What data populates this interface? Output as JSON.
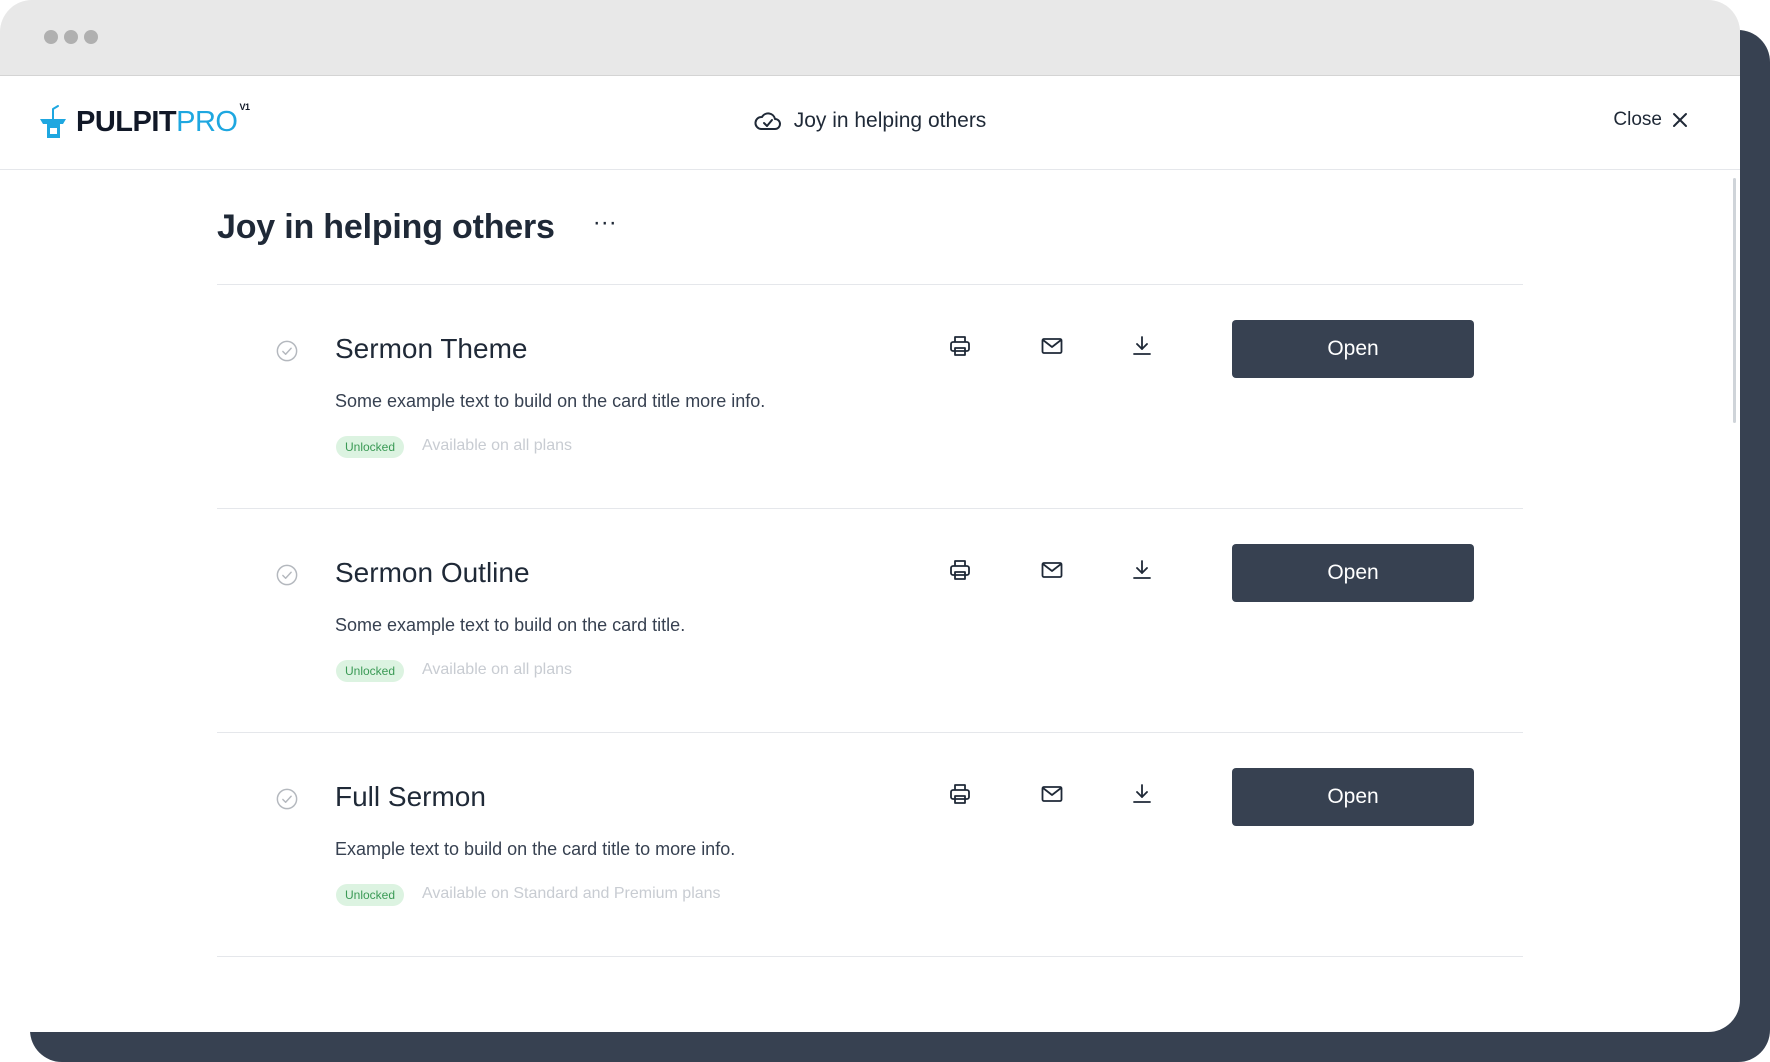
{
  "app": {
    "logo_pulpit": "PULPIT",
    "logo_pro": "PRO",
    "logo_version": "V1",
    "header_title": "Joy in helping others",
    "close_label": "Close"
  },
  "page": {
    "title": "Joy in helping others",
    "more_label": "···"
  },
  "cards": [
    {
      "title": "Sermon Theme",
      "description": "Some example text to build on the card title more info.",
      "badge": "Unlocked",
      "availability": "Available on all plans",
      "open_label": "Open"
    },
    {
      "title": "Sermon Outline",
      "description": "Some example text to build on the card title.",
      "badge": "Unlocked",
      "availability": "Available on all plans",
      "open_label": "Open"
    },
    {
      "title": "Full Sermon",
      "description": "Example text to build on the card title to more info.",
      "badge": "Unlocked",
      "availability": "Available on Standard and Premium plans",
      "open_label": "Open"
    }
  ],
  "icons": {
    "header": "cloud-check-icon",
    "close": "close-icon",
    "status": "check-circle-icon",
    "print": "printer-icon",
    "mail": "mail-icon",
    "download": "download-icon"
  },
  "colors": {
    "brand_blue": "#1ea7e0",
    "button_dark": "#374151",
    "badge_bg": "#dcf3e1",
    "badge_text": "#3a9a55",
    "frame": "#374151"
  }
}
